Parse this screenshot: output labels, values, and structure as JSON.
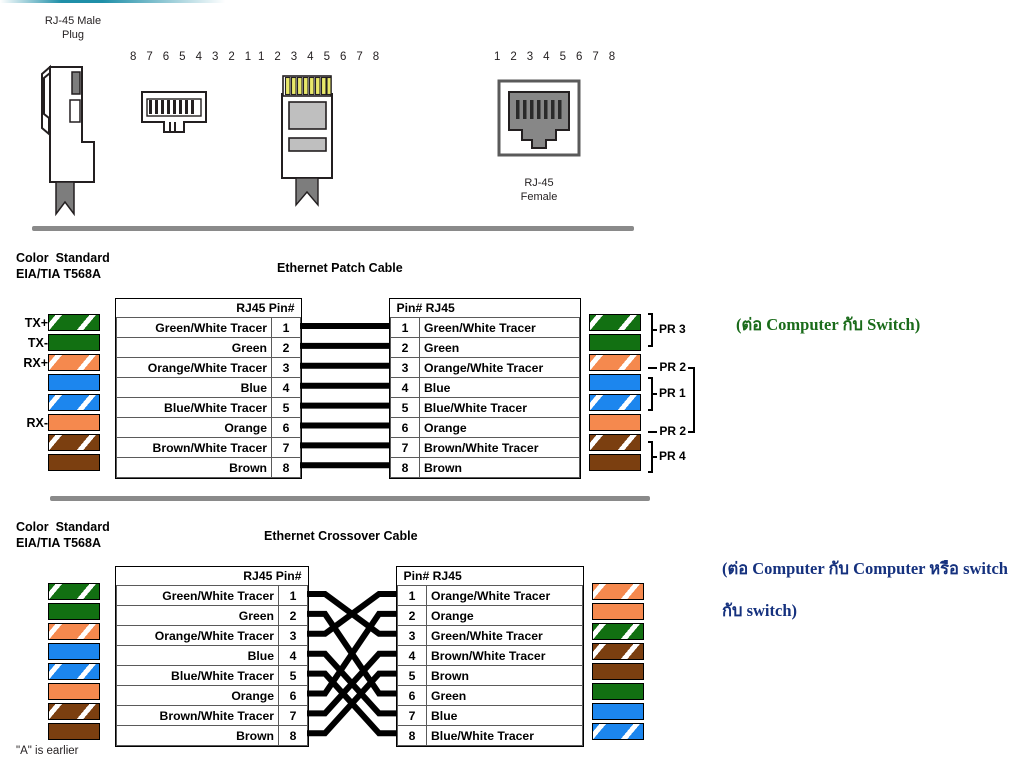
{
  "page": {
    "title": "Ethernet RJ-45 Cable Wiring Diagram"
  },
  "connectors": {
    "male_plug_label": "RJ-45 Male\nPlug",
    "female_label": "RJ-45\nFemale",
    "pin_numbers_reversed": "8 7 6 5 4 3 2 1",
    "pin_numbers_forward": "1 2 3 4 5 6 7 8",
    "pin_numbers_female": "1 2 3 4 5 6 7 8"
  },
  "patch": {
    "standard_label": "Color  Standard\nEIA/TIA T568A",
    "title": "Ethernet Patch Cable",
    "left_header": "RJ45   Pin#",
    "right_header": "Pin#   RJ45",
    "signals": [
      "TX+",
      "TX-",
      "RX+",
      "",
      "",
      "RX-",
      "",
      ""
    ],
    "left_rows": [
      {
        "pin": "1",
        "name": "Green/White Tracer",
        "color": "green",
        "tracer": true
      },
      {
        "pin": "2",
        "name": "Green",
        "color": "green",
        "tracer": false
      },
      {
        "pin": "3",
        "name": "Orange/White Tracer",
        "color": "orange",
        "tracer": true
      },
      {
        "pin": "4",
        "name": "Blue",
        "color": "blue",
        "tracer": false
      },
      {
        "pin": "5",
        "name": "Blue/White Tracer",
        "color": "blue",
        "tracer": true
      },
      {
        "pin": "6",
        "name": "Orange",
        "color": "orange",
        "tracer": false
      },
      {
        "pin": "7",
        "name": "Brown/White Tracer",
        "color": "brown",
        "tracer": true
      },
      {
        "pin": "8",
        "name": "Brown",
        "color": "brown",
        "tracer": false
      }
    ],
    "right_rows": [
      {
        "pin": "1",
        "name": "Green/White Tracer",
        "color": "green",
        "tracer": true
      },
      {
        "pin": "2",
        "name": "Green",
        "color": "green",
        "tracer": false
      },
      {
        "pin": "3",
        "name": "Orange/White Tracer",
        "color": "orange",
        "tracer": true
      },
      {
        "pin": "4",
        "name": "Blue",
        "color": "blue",
        "tracer": false
      },
      {
        "pin": "5",
        "name": "Blue/White Tracer",
        "color": "blue",
        "tracer": true
      },
      {
        "pin": "6",
        "name": "Orange",
        "color": "orange",
        "tracer": false
      },
      {
        "pin": "7",
        "name": "Brown/White Tracer",
        "color": "brown",
        "tracer": true
      },
      {
        "pin": "8",
        "name": "Brown",
        "color": "brown",
        "tracer": false
      }
    ],
    "pair_labels": [
      "PR 3",
      "- PR 2",
      "PR 1",
      "- PR 2",
      "PR 4"
    ],
    "mapping": [
      [
        1,
        1
      ],
      [
        2,
        2
      ],
      [
        3,
        3
      ],
      [
        4,
        4
      ],
      [
        5,
        5
      ],
      [
        6,
        6
      ],
      [
        7,
        7
      ],
      [
        8,
        8
      ]
    ],
    "callout": "(ต่อ Computer กับ Switch)"
  },
  "crossover": {
    "standard_label": "Color  Standard\nEIA/TIA T568A",
    "title": "Ethernet Crossover Cable",
    "left_header": "RJ45   Pin#",
    "right_header": "Pin#   RJ45",
    "left_rows": [
      {
        "pin": "1",
        "name": "Green/White Tracer",
        "color": "green",
        "tracer": true
      },
      {
        "pin": "2",
        "name": "Green",
        "color": "green",
        "tracer": false
      },
      {
        "pin": "3",
        "name": "Orange/White Tracer",
        "color": "orange",
        "tracer": true
      },
      {
        "pin": "4",
        "name": "Blue",
        "color": "blue",
        "tracer": false
      },
      {
        "pin": "5",
        "name": "Blue/White Tracer",
        "color": "blue",
        "tracer": true
      },
      {
        "pin": "6",
        "name": "Orange",
        "color": "orange",
        "tracer": false
      },
      {
        "pin": "7",
        "name": "Brown/White Tracer",
        "color": "brown",
        "tracer": true
      },
      {
        "pin": "8",
        "name": "Brown",
        "color": "brown",
        "tracer": false
      }
    ],
    "right_rows": [
      {
        "pin": "1",
        "name": "Orange/White Tracer",
        "color": "orange",
        "tracer": true
      },
      {
        "pin": "2",
        "name": "Orange",
        "color": "orange",
        "tracer": false
      },
      {
        "pin": "3",
        "name": "Green/White Tracer",
        "color": "green",
        "tracer": true
      },
      {
        "pin": "4",
        "name": "Brown/White Tracer",
        "color": "brown",
        "tracer": true
      },
      {
        "pin": "5",
        "name": "Brown",
        "color": "brown",
        "tracer": false
      },
      {
        "pin": "6",
        "name": "Green",
        "color": "green",
        "tracer": false
      },
      {
        "pin": "7",
        "name": "Blue",
        "color": "blue",
        "tracer": false
      },
      {
        "pin": "8",
        "name": "Blue/White Tracer",
        "color": "blue",
        "tracer": true
      }
    ],
    "mapping": [
      [
        1,
        3
      ],
      [
        2,
        6
      ],
      [
        3,
        1
      ],
      [
        4,
        7
      ],
      [
        5,
        8
      ],
      [
        6,
        2
      ],
      [
        7,
        4
      ],
      [
        8,
        5
      ]
    ],
    "footnote": "\"A\" is earlier",
    "callout": "(ต่อ Computer กับ Computer หรือ switch กับ switch)"
  },
  "colors": {
    "green": "#127012",
    "orange": "#F5894E",
    "blue": "#1C86EE",
    "brown": "#7B3F10",
    "divider": "#8a8a8a",
    "callout_green": "#1a6b1a",
    "callout_blue": "#15317e",
    "gold_pin": "#E8E86A",
    "plug_gray": "#808080",
    "body_gray": "#C0C0C0"
  }
}
